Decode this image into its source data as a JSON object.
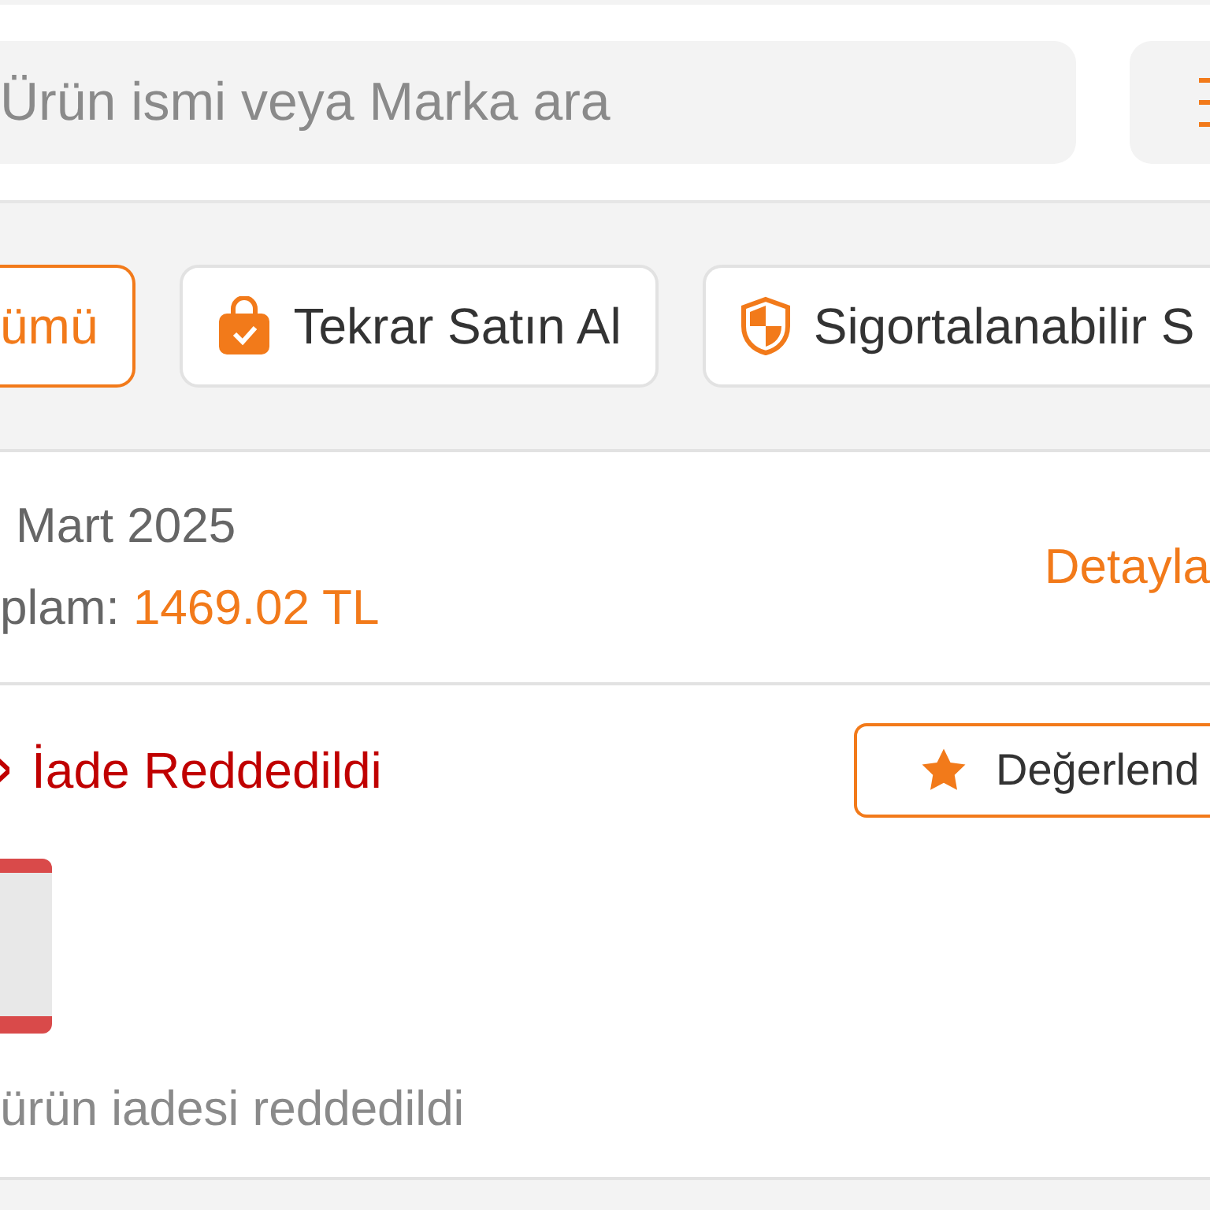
{
  "search": {
    "placeholder": "Ürün ismi veya Marka ara"
  },
  "filters": [
    {
      "label": "ümü",
      "selected": true,
      "kind": "plain"
    },
    {
      "label": "Tekrar Satın Al",
      "selected": false,
      "kind": "bag"
    },
    {
      "label": "Sigortalanabilir S",
      "selected": false,
      "kind": "shield"
    }
  ],
  "order": {
    "date": "Mart 2025",
    "total_label": "plam:",
    "total_value": "1469.02 TL",
    "details_link": "Detayla"
  },
  "shipment": {
    "status": "İade Reddedildi",
    "rate_button": "Değerlend",
    "note": "ürün iadesi reddedildi"
  }
}
